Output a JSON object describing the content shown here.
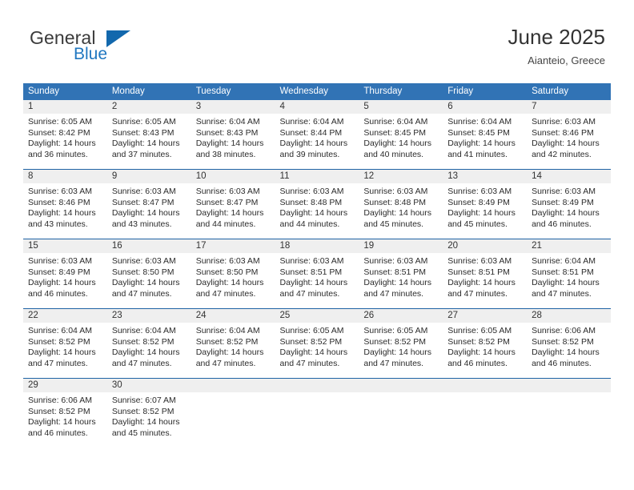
{
  "brand": {
    "name_part1": "General",
    "name_part2": "Blue",
    "triangle_icon": "brand-triangle-icon",
    "accent_color": "#1268ad"
  },
  "header": {
    "month_title": "June 2025",
    "location": "Aianteio, Greece"
  },
  "theme": {
    "header_blue": "#3173b5",
    "row_divider_blue": "#1f63a5",
    "daynum_band_gray": "#efefef",
    "brand_blue_text": "#2077c0"
  },
  "calendar": {
    "weekday_headers": [
      "Sunday",
      "Monday",
      "Tuesday",
      "Wednesday",
      "Thursday",
      "Friday",
      "Saturday"
    ],
    "weeks": [
      [
        {
          "day": "1",
          "sunrise": "Sunrise: 6:05 AM",
          "sunset": "Sunset: 8:42 PM",
          "daylight": "Daylight: 14 hours and 36 minutes."
        },
        {
          "day": "2",
          "sunrise": "Sunrise: 6:05 AM",
          "sunset": "Sunset: 8:43 PM",
          "daylight": "Daylight: 14 hours and 37 minutes."
        },
        {
          "day": "3",
          "sunrise": "Sunrise: 6:04 AM",
          "sunset": "Sunset: 8:43 PM",
          "daylight": "Daylight: 14 hours and 38 minutes."
        },
        {
          "day": "4",
          "sunrise": "Sunrise: 6:04 AM",
          "sunset": "Sunset: 8:44 PM",
          "daylight": "Daylight: 14 hours and 39 minutes."
        },
        {
          "day": "5",
          "sunrise": "Sunrise: 6:04 AM",
          "sunset": "Sunset: 8:45 PM",
          "daylight": "Daylight: 14 hours and 40 minutes."
        },
        {
          "day": "6",
          "sunrise": "Sunrise: 6:04 AM",
          "sunset": "Sunset: 8:45 PM",
          "daylight": "Daylight: 14 hours and 41 minutes."
        },
        {
          "day": "7",
          "sunrise": "Sunrise: 6:03 AM",
          "sunset": "Sunset: 8:46 PM",
          "daylight": "Daylight: 14 hours and 42 minutes."
        }
      ],
      [
        {
          "day": "8",
          "sunrise": "Sunrise: 6:03 AM",
          "sunset": "Sunset: 8:46 PM",
          "daylight": "Daylight: 14 hours and 43 minutes."
        },
        {
          "day": "9",
          "sunrise": "Sunrise: 6:03 AM",
          "sunset": "Sunset: 8:47 PM",
          "daylight": "Daylight: 14 hours and 43 minutes."
        },
        {
          "day": "10",
          "sunrise": "Sunrise: 6:03 AM",
          "sunset": "Sunset: 8:47 PM",
          "daylight": "Daylight: 14 hours and 44 minutes."
        },
        {
          "day": "11",
          "sunrise": "Sunrise: 6:03 AM",
          "sunset": "Sunset: 8:48 PM",
          "daylight": "Daylight: 14 hours and 44 minutes."
        },
        {
          "day": "12",
          "sunrise": "Sunrise: 6:03 AM",
          "sunset": "Sunset: 8:48 PM",
          "daylight": "Daylight: 14 hours and 45 minutes."
        },
        {
          "day": "13",
          "sunrise": "Sunrise: 6:03 AM",
          "sunset": "Sunset: 8:49 PM",
          "daylight": "Daylight: 14 hours and 45 minutes."
        },
        {
          "day": "14",
          "sunrise": "Sunrise: 6:03 AM",
          "sunset": "Sunset: 8:49 PM",
          "daylight": "Daylight: 14 hours and 46 minutes."
        }
      ],
      [
        {
          "day": "15",
          "sunrise": "Sunrise: 6:03 AM",
          "sunset": "Sunset: 8:49 PM",
          "daylight": "Daylight: 14 hours and 46 minutes."
        },
        {
          "day": "16",
          "sunrise": "Sunrise: 6:03 AM",
          "sunset": "Sunset: 8:50 PM",
          "daylight": "Daylight: 14 hours and 47 minutes."
        },
        {
          "day": "17",
          "sunrise": "Sunrise: 6:03 AM",
          "sunset": "Sunset: 8:50 PM",
          "daylight": "Daylight: 14 hours and 47 minutes."
        },
        {
          "day": "18",
          "sunrise": "Sunrise: 6:03 AM",
          "sunset": "Sunset: 8:51 PM",
          "daylight": "Daylight: 14 hours and 47 minutes."
        },
        {
          "day": "19",
          "sunrise": "Sunrise: 6:03 AM",
          "sunset": "Sunset: 8:51 PM",
          "daylight": "Daylight: 14 hours and 47 minutes."
        },
        {
          "day": "20",
          "sunrise": "Sunrise: 6:03 AM",
          "sunset": "Sunset: 8:51 PM",
          "daylight": "Daylight: 14 hours and 47 minutes."
        },
        {
          "day": "21",
          "sunrise": "Sunrise: 6:04 AM",
          "sunset": "Sunset: 8:51 PM",
          "daylight": "Daylight: 14 hours and 47 minutes."
        }
      ],
      [
        {
          "day": "22",
          "sunrise": "Sunrise: 6:04 AM",
          "sunset": "Sunset: 8:52 PM",
          "daylight": "Daylight: 14 hours and 47 minutes."
        },
        {
          "day": "23",
          "sunrise": "Sunrise: 6:04 AM",
          "sunset": "Sunset: 8:52 PM",
          "daylight": "Daylight: 14 hours and 47 minutes."
        },
        {
          "day": "24",
          "sunrise": "Sunrise: 6:04 AM",
          "sunset": "Sunset: 8:52 PM",
          "daylight": "Daylight: 14 hours and 47 minutes."
        },
        {
          "day": "25",
          "sunrise": "Sunrise: 6:05 AM",
          "sunset": "Sunset: 8:52 PM",
          "daylight": "Daylight: 14 hours and 47 minutes."
        },
        {
          "day": "26",
          "sunrise": "Sunrise: 6:05 AM",
          "sunset": "Sunset: 8:52 PM",
          "daylight": "Daylight: 14 hours and 47 minutes."
        },
        {
          "day": "27",
          "sunrise": "Sunrise: 6:05 AM",
          "sunset": "Sunset: 8:52 PM",
          "daylight": "Daylight: 14 hours and 46 minutes."
        },
        {
          "day": "28",
          "sunrise": "Sunrise: 6:06 AM",
          "sunset": "Sunset: 8:52 PM",
          "daylight": "Daylight: 14 hours and 46 minutes."
        }
      ],
      [
        {
          "day": "29",
          "sunrise": "Sunrise: 6:06 AM",
          "sunset": "Sunset: 8:52 PM",
          "daylight": "Daylight: 14 hours and 46 minutes."
        },
        {
          "day": "30",
          "sunrise": "Sunrise: 6:07 AM",
          "sunset": "Sunset: 8:52 PM",
          "daylight": "Daylight: 14 hours and 45 minutes."
        },
        {
          "day": "",
          "sunrise": "",
          "sunset": "",
          "daylight": ""
        },
        {
          "day": "",
          "sunrise": "",
          "sunset": "",
          "daylight": ""
        },
        {
          "day": "",
          "sunrise": "",
          "sunset": "",
          "daylight": ""
        },
        {
          "day": "",
          "sunrise": "",
          "sunset": "",
          "daylight": ""
        },
        {
          "day": "",
          "sunrise": "",
          "sunset": "",
          "daylight": ""
        }
      ]
    ]
  }
}
